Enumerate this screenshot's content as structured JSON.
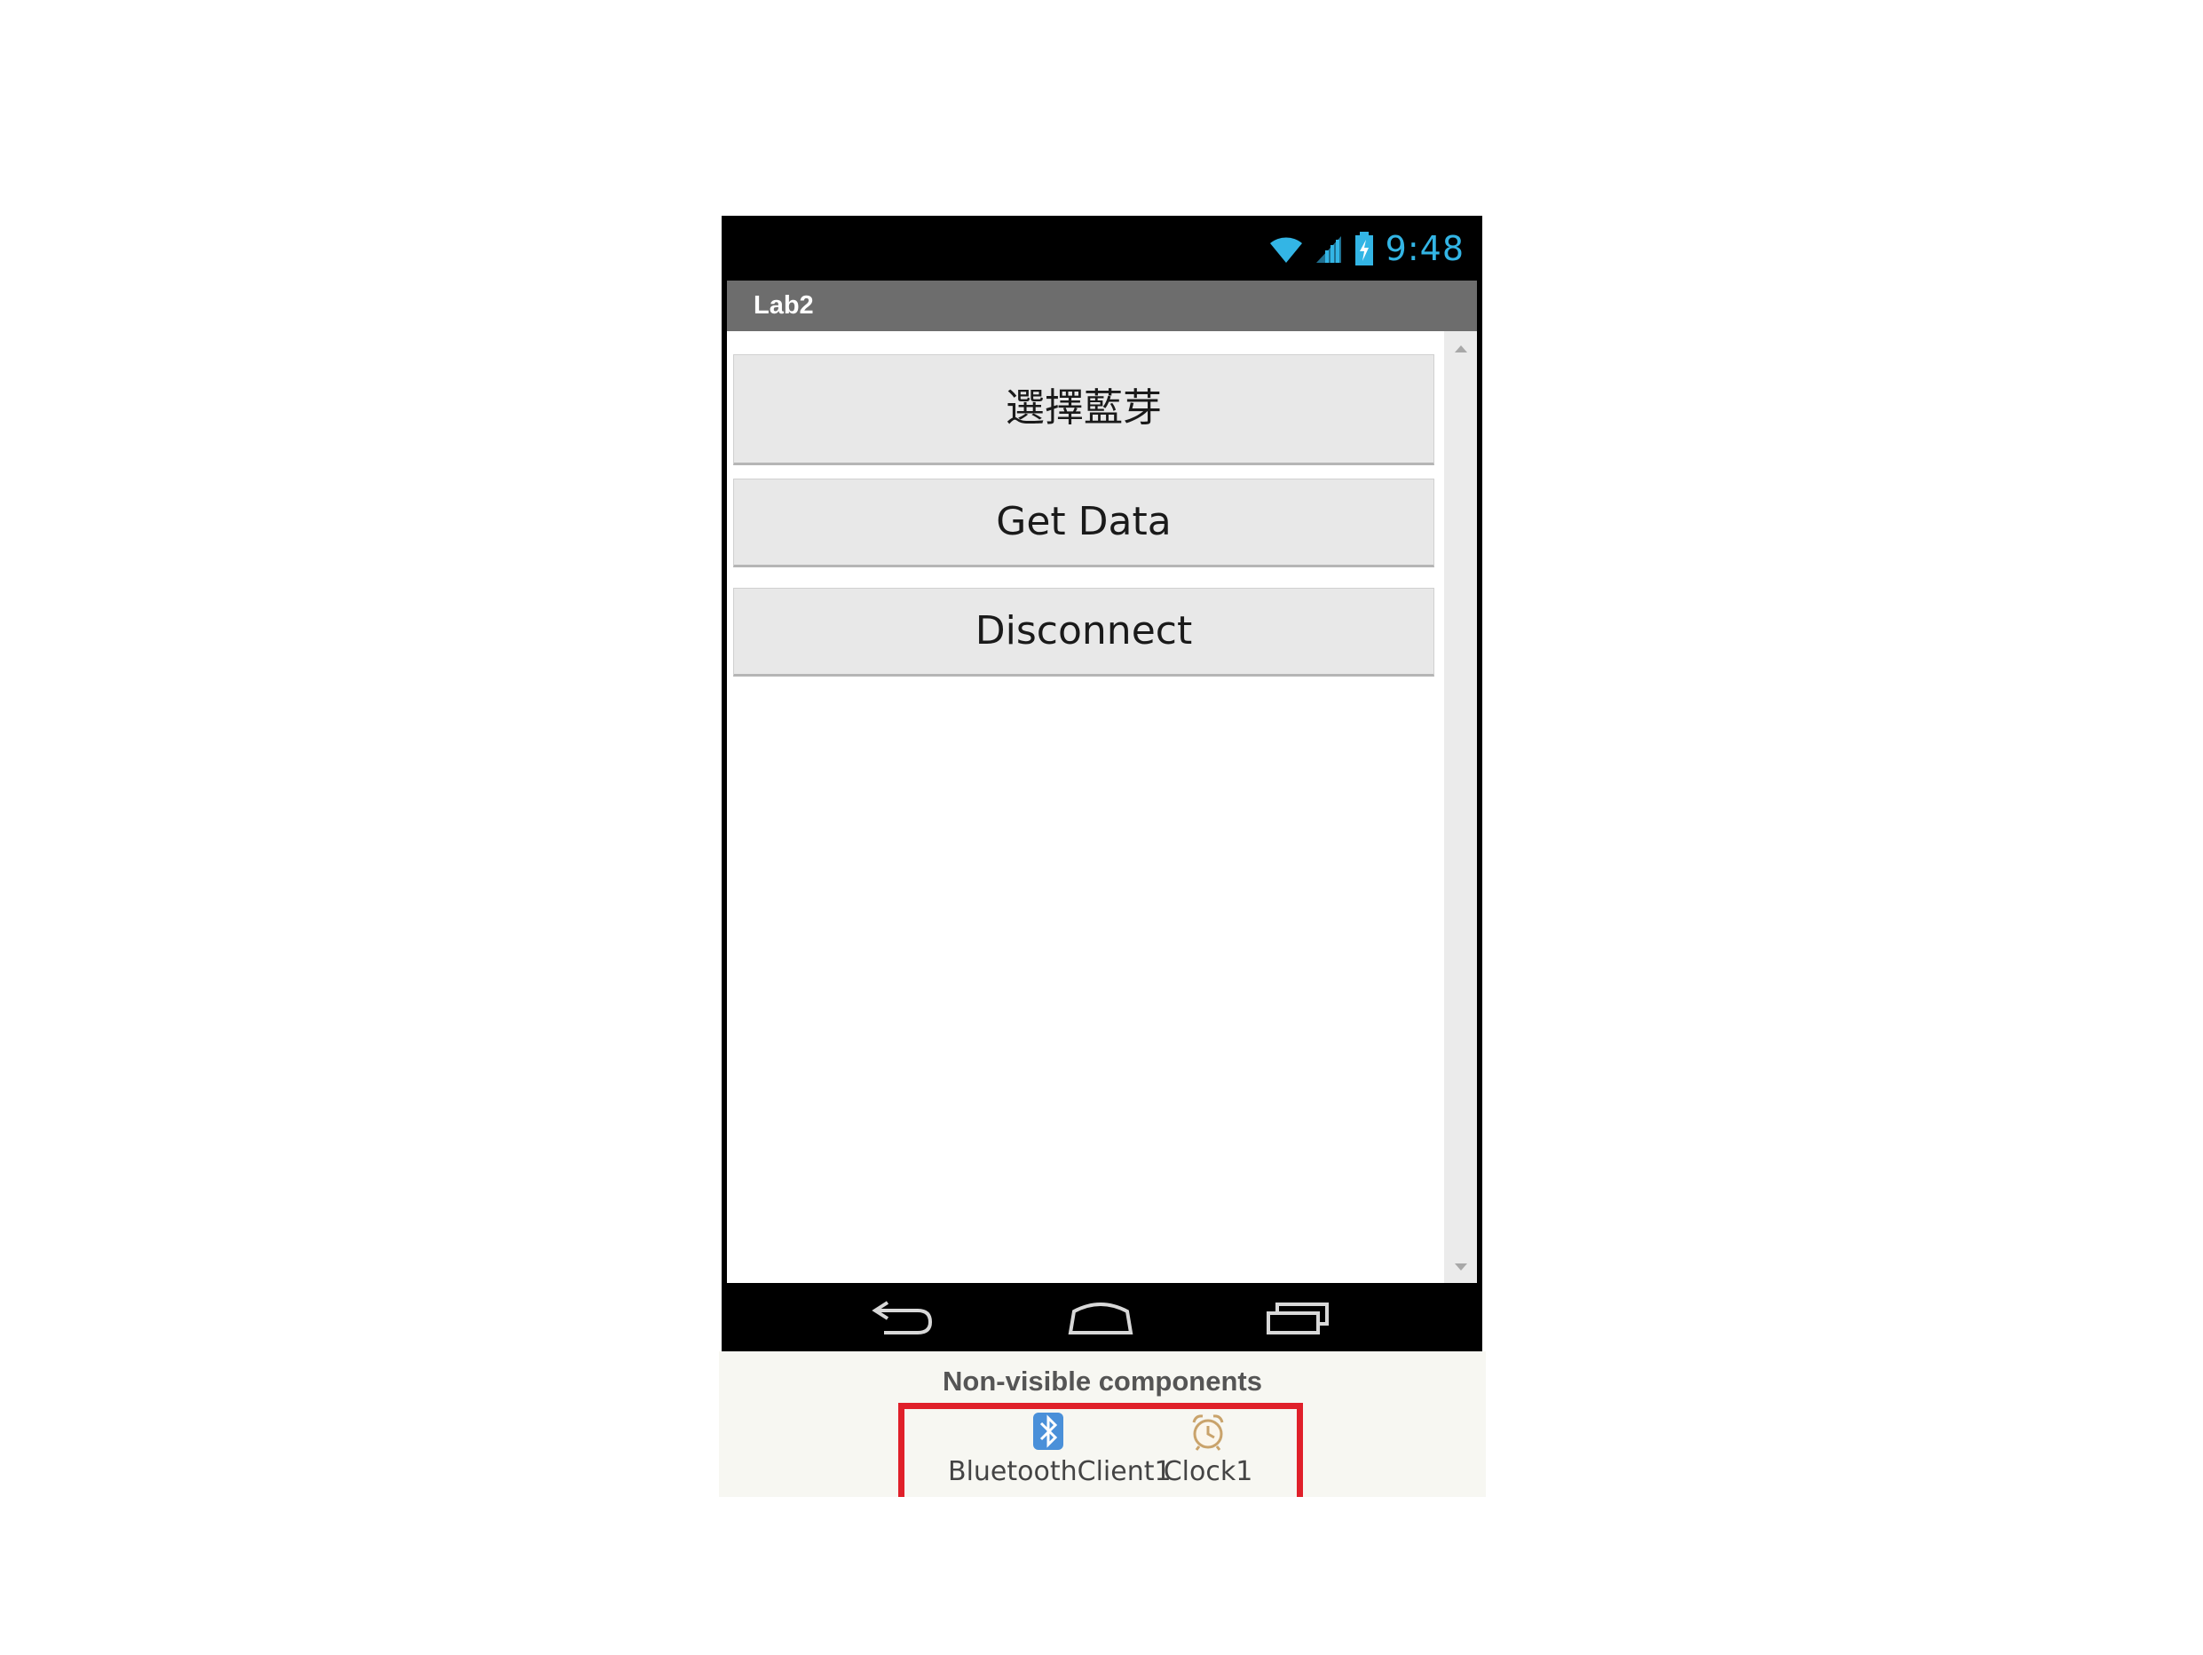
{
  "status_bar": {
    "time": "9:48",
    "icons": [
      "wifi-icon",
      "signal-icon",
      "battery-charging-icon"
    ],
    "accent_color": "#33b5e5"
  },
  "app": {
    "title": "Lab2"
  },
  "buttons": {
    "select_bluetooth": "選擇藍芽",
    "get_data": "Get Data",
    "disconnect": "Disconnect"
  },
  "nav_bar": {
    "icons": [
      "back-icon",
      "home-icon",
      "recent-apps-icon"
    ]
  },
  "non_visible": {
    "title": "Non-visible components",
    "components": [
      {
        "label": "BluetoothClient1",
        "icon": "bluetooth-icon"
      },
      {
        "label": "Clock1",
        "icon": "alarm-clock-icon"
      }
    ],
    "highlight_color": "#e0202a"
  }
}
